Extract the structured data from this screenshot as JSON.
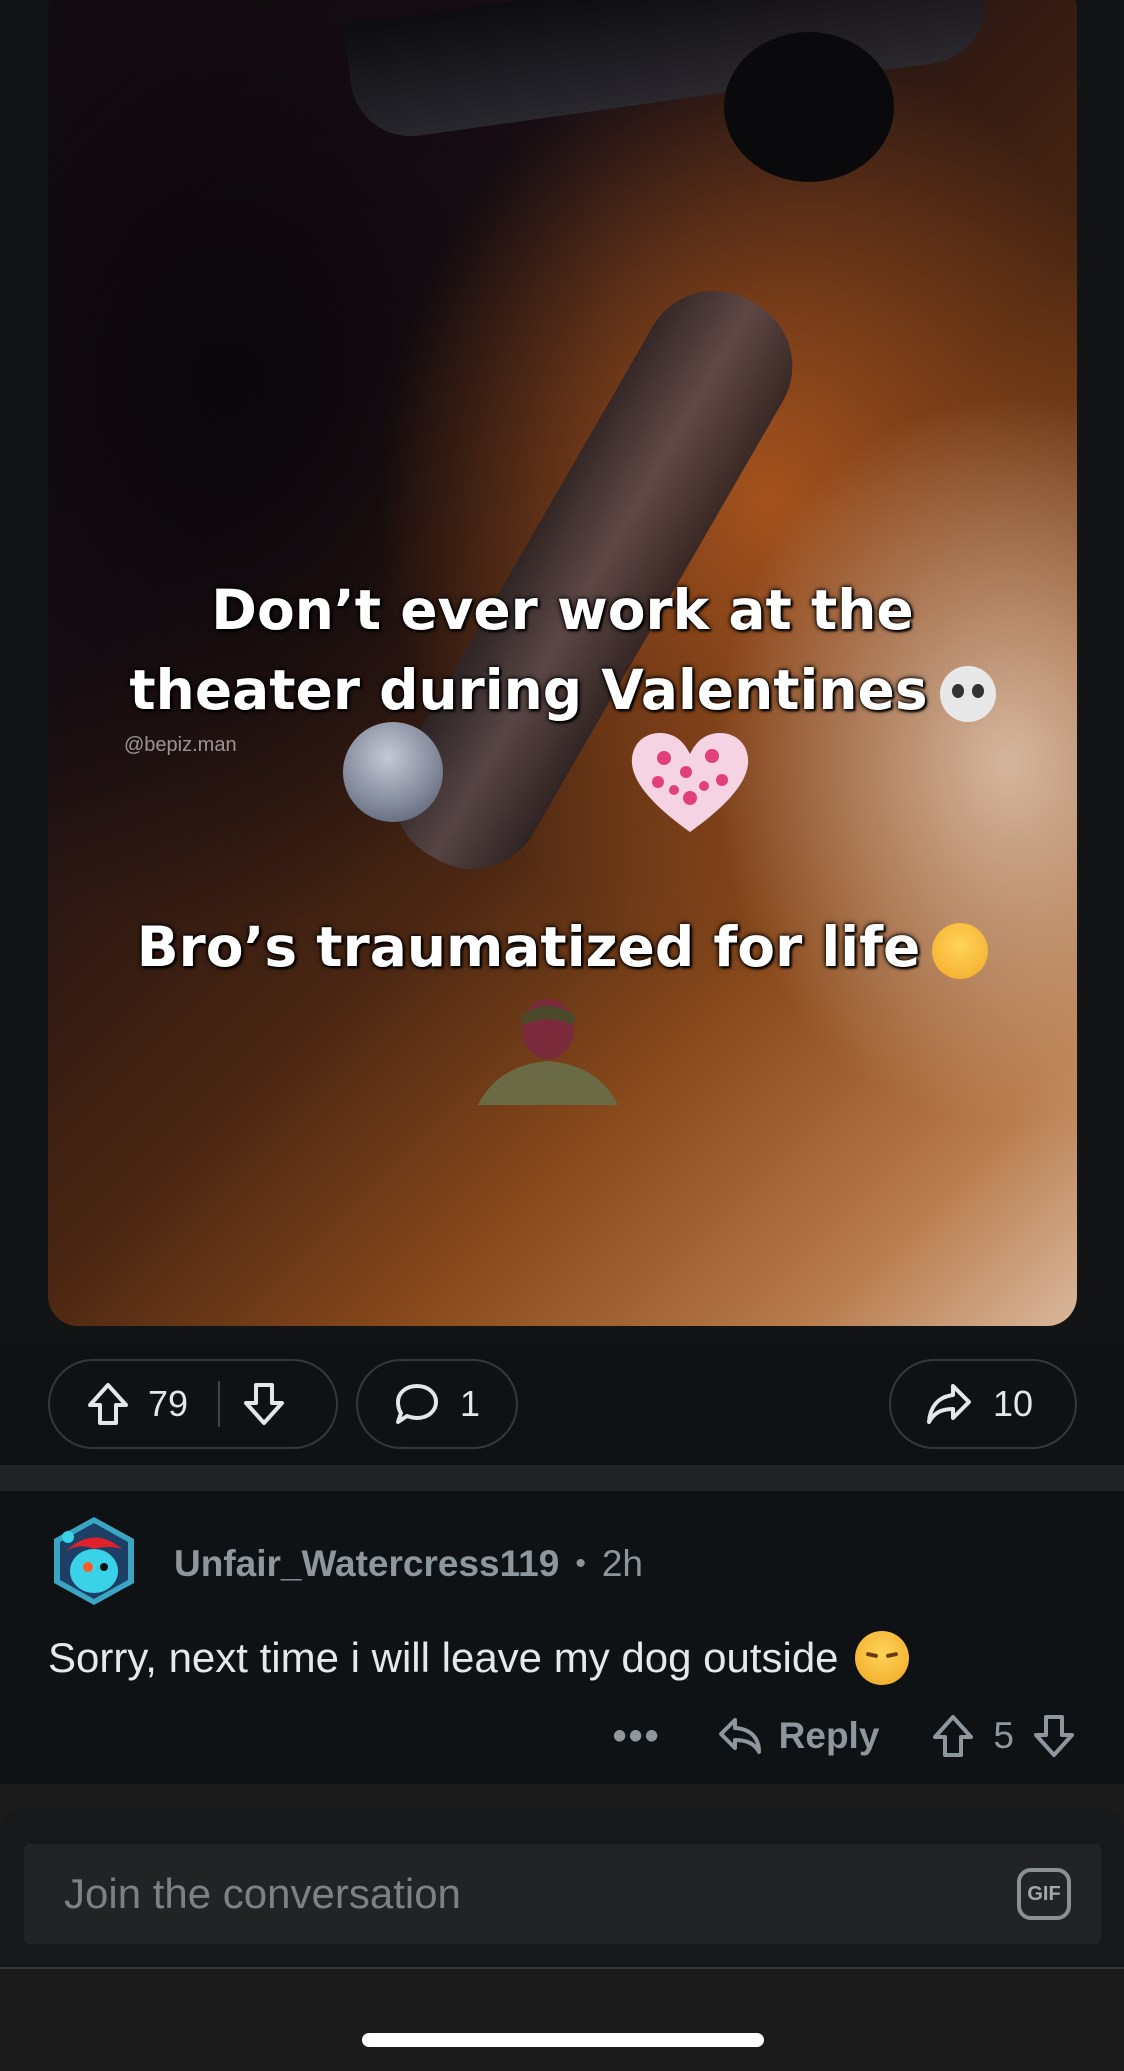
{
  "post": {
    "media": {
      "caption_line_1": "Don’t ever work at the",
      "caption_line_2": "theater during Valentines",
      "caption_line_3": "Bro’s traumatized for life",
      "watermark": "@bepiz.man"
    },
    "actions": {
      "upvote_count": "79",
      "comment_count": "1",
      "share_count": "10"
    }
  },
  "comment": {
    "username": "Unfair_Watercress119",
    "separator": "•",
    "age": "2h",
    "body": "Sorry, next time i will leave my dog outside",
    "more_label": "•••",
    "reply_label": "Reply",
    "vote_count": "5"
  },
  "composer": {
    "placeholder": "Join the conversation",
    "gif_label": "GIF"
  },
  "colors": {
    "background": "#1b1b1c",
    "card": "#0f1215",
    "muted_text": "#8e979e",
    "body_text": "#e6e8ea"
  },
  "icons": [
    "upvote-icon",
    "downvote-icon",
    "comment-icon",
    "share-icon",
    "reply-icon",
    "more-icon",
    "gif-icon",
    "skull-emoji-icon",
    "crying-emoji-icon",
    "pensive-emoji-icon"
  ]
}
